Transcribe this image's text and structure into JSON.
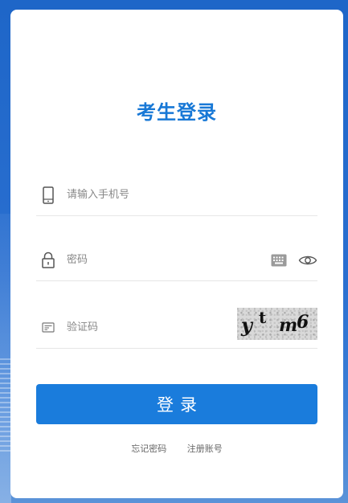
{
  "page": {
    "title": "考生登录"
  },
  "form": {
    "phone": {
      "placeholder": "请输入手机号",
      "value": ""
    },
    "password": {
      "placeholder": "密码",
      "value": ""
    },
    "captcha": {
      "placeholder": "验证码",
      "value": "",
      "image_chars": [
        "y",
        "t",
        "m",
        "6"
      ]
    }
  },
  "actions": {
    "login_label": "登录",
    "forgot_password": "忘记密码",
    "register": "注册账号"
  },
  "icons": {
    "phone": "phone-icon",
    "lock": "lock-icon",
    "captcha": "captcha-card-icon",
    "keyboard": "keyboard-icon",
    "eye": "eye-icon"
  },
  "colors": {
    "accent": "#1878d6",
    "button": "#1a7cdc",
    "background": "#1e66c8"
  }
}
